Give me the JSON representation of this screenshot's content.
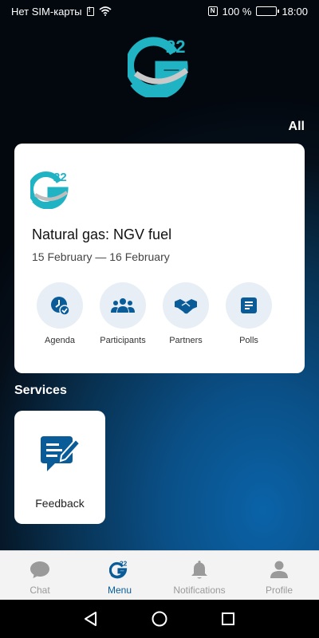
{
  "status_bar": {
    "carrier": "Нет SIM-карты",
    "battery": "100 %",
    "time": "18:00",
    "nfc": "N"
  },
  "header": {
    "all_link": "All",
    "logo_text": "22"
  },
  "event": {
    "logo_text": "22",
    "title": "Natural gas: NGV fuel",
    "dates": "15 February — 16 February",
    "actions": [
      {
        "label": "Agenda",
        "icon": "agenda-icon"
      },
      {
        "label": "Participants",
        "icon": "participants-icon"
      },
      {
        "label": "Partners",
        "icon": "handshake-icon"
      },
      {
        "label": "Polls",
        "icon": "polls-icon"
      }
    ]
  },
  "services": {
    "heading": "Services",
    "items": [
      {
        "label": "Feedback",
        "icon": "feedback-icon"
      }
    ]
  },
  "tab_bar": {
    "tabs": [
      {
        "label": "Chat",
        "icon": "chat-icon",
        "active": false
      },
      {
        "label": "Menu",
        "icon": "logo-icon",
        "active": true
      },
      {
        "label": "Notifications",
        "icon": "bell-icon",
        "active": false
      },
      {
        "label": "Profile",
        "icon": "profile-icon",
        "active": false
      }
    ],
    "menu_logo_text": "22"
  },
  "colors": {
    "accent": "#0a5c99",
    "logo_teal": "#1fb3c4",
    "action_bg": "#e7eef5"
  }
}
